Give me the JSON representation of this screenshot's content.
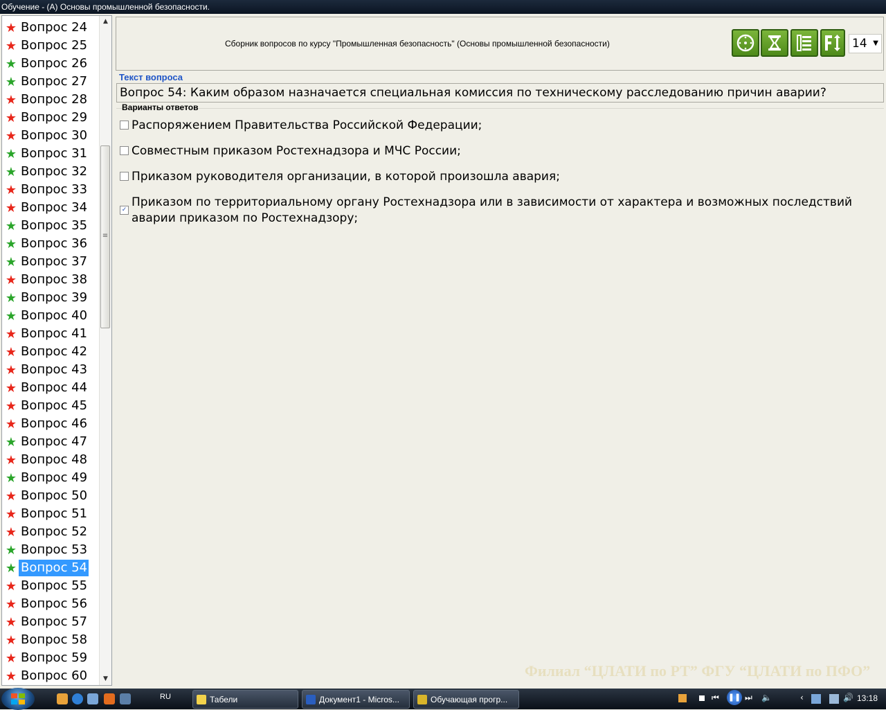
{
  "window": {
    "title": "Обучение - (A) Основы промышленной безопасности."
  },
  "sidebar": {
    "items": [
      {
        "label": "Вопрос 24",
        "status": "red"
      },
      {
        "label": "Вопрос 25",
        "status": "red"
      },
      {
        "label": "Вопрос 26",
        "status": "green"
      },
      {
        "label": "Вопрос 27",
        "status": "green"
      },
      {
        "label": "Вопрос 28",
        "status": "red"
      },
      {
        "label": "Вопрос 29",
        "status": "red"
      },
      {
        "label": "Вопрос 30",
        "status": "red"
      },
      {
        "label": "Вопрос 31",
        "status": "green"
      },
      {
        "label": "Вопрос 32",
        "status": "green"
      },
      {
        "label": "Вопрос 33",
        "status": "red"
      },
      {
        "label": "Вопрос 34",
        "status": "red"
      },
      {
        "label": "Вопрос 35",
        "status": "green"
      },
      {
        "label": "Вопрос 36",
        "status": "green"
      },
      {
        "label": "Вопрос 37",
        "status": "green"
      },
      {
        "label": "Вопрос 38",
        "status": "red"
      },
      {
        "label": "Вопрос 39",
        "status": "green"
      },
      {
        "label": "Вопрос 40",
        "status": "green"
      },
      {
        "label": "Вопрос 41",
        "status": "red"
      },
      {
        "label": "Вопрос 42",
        "status": "red"
      },
      {
        "label": "Вопрос 43",
        "status": "red"
      },
      {
        "label": "Вопрос 44",
        "status": "red"
      },
      {
        "label": "Вопрос 45",
        "status": "red"
      },
      {
        "label": "Вопрос 46",
        "status": "red"
      },
      {
        "label": "Вопрос 47",
        "status": "green"
      },
      {
        "label": "Вопрос 48",
        "status": "red"
      },
      {
        "label": "Вопрос 49",
        "status": "green"
      },
      {
        "label": "Вопрос 50",
        "status": "red"
      },
      {
        "label": "Вопрос 51",
        "status": "red"
      },
      {
        "label": "Вопрос 52",
        "status": "red"
      },
      {
        "label": "Вопрос 53",
        "status": "green"
      },
      {
        "label": "Вопрос 54",
        "status": "green",
        "selected": true
      },
      {
        "label": "Вопрос 55",
        "status": "red"
      },
      {
        "label": "Вопрос 56",
        "status": "red"
      },
      {
        "label": "Вопрос 57",
        "status": "red"
      },
      {
        "label": "Вопрос 58",
        "status": "red"
      },
      {
        "label": "Вопрос 59",
        "status": "red"
      },
      {
        "label": "Вопрос 60",
        "status": "red"
      }
    ],
    "scroll_up_icon": "scroll-up-arrow",
    "scroll_down_icon": "scroll-down-arrow"
  },
  "header": {
    "course_title": "Сборник вопросов по курсу \"Промышленная безопасность\" (Основы промышленной безопасности)",
    "tools": [
      {
        "icon": "clock-icon"
      },
      {
        "icon": "hourglass-icon"
      },
      {
        "icon": "list-icon"
      },
      {
        "icon": "font-size-icon"
      }
    ],
    "font_size_value": "14"
  },
  "question": {
    "section_label": "Текст вопроса",
    "text": "Вопрос 54: Каким образом назначается специальная комиссия по техническому расследованию причин аварии?"
  },
  "answers": {
    "section_label": "Варианты ответов",
    "items": [
      {
        "text": "Распоряжением Правительства Российской Федерации;",
        "checked": false,
        "correct": false
      },
      {
        "text": "Совместным приказом Ростехнадзора и МЧС России;",
        "checked": false,
        "correct": false
      },
      {
        "text": "Приказом руководителя организации, в которой произошла авария;",
        "checked": false,
        "correct": false
      },
      {
        "text": "Приказом по территориальному органу Ростехнадзора или в зависимости от характера и возможных последствий аварии приказом по Ростехнадзору;",
        "checked": true,
        "correct": true
      }
    ]
  },
  "watermark": "Филиал “ЦЛАТИ по РТ” ФГУ “ЦЛАТИ по ПФО”",
  "taskbar": {
    "language": "RU",
    "tasks": [
      {
        "label": "Табели"
      },
      {
        "label": "Документ1 - Micros..."
      },
      {
        "label": "Обучающая прогр..."
      }
    ],
    "clock": "13:18"
  },
  "colors": {
    "wrong_answer_bg": "#f4b690",
    "correct_answer_bg": "#bdfd74",
    "selected_item_bg": "#3399ff",
    "star_red": "#e8261a",
    "star_green": "#2aa52a"
  }
}
